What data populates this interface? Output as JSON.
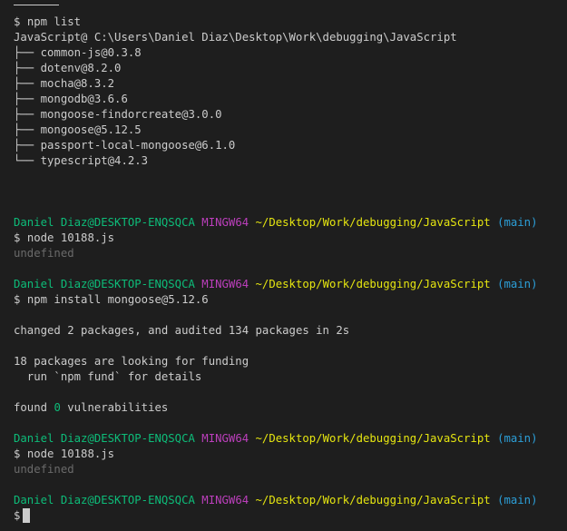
{
  "terminal": {
    "colors": {
      "background": "#1e1e1e",
      "foreground": "#cccccc",
      "user_host": "#0dbc79",
      "mingw": "#bc3fbc",
      "path": "#e5e510",
      "branch": "#2c9fd8",
      "dim": "#6a6a6a"
    },
    "prompt": {
      "user_host": "Daniel Diaz@DESKTOP-ENQSQCA",
      "system": "MINGW64",
      "path": "~/Desktop/Work/debugging/JavaScript",
      "branch": "(main)",
      "symbol": "$"
    },
    "npm_list": {
      "command": "npm list",
      "root": "JavaScript@ C:\\Users\\Daniel Diaz\\Desktop\\Work\\debugging\\JavaScript",
      "deps": [
        "├── common-js@0.3.8",
        "├── dotenv@8.2.0",
        "├── mocha@8.3.2",
        "├── mongodb@3.6.6",
        "├── mongoose-findorcreate@3.0.0",
        "├── mongoose@5.12.5",
        "├── passport-local-mongoose@6.1.0",
        "└── typescript@4.2.3"
      ]
    },
    "cmd_node_1": "node 10188.js",
    "out_undefined_1": "undefined",
    "cmd_install": "npm install mongoose@5.12.6",
    "out_changed": "changed 2 packages, and audited 134 packages in 2s",
    "out_funding_1": "18 packages are looking for funding",
    "out_funding_2": "  run `npm fund` for details",
    "out_found_prefix": "found",
    "out_found_count": "0",
    "out_found_suffix": "vulnerabilities",
    "cmd_node_2": "node 10188.js",
    "out_undefined_2": "undefined"
  }
}
